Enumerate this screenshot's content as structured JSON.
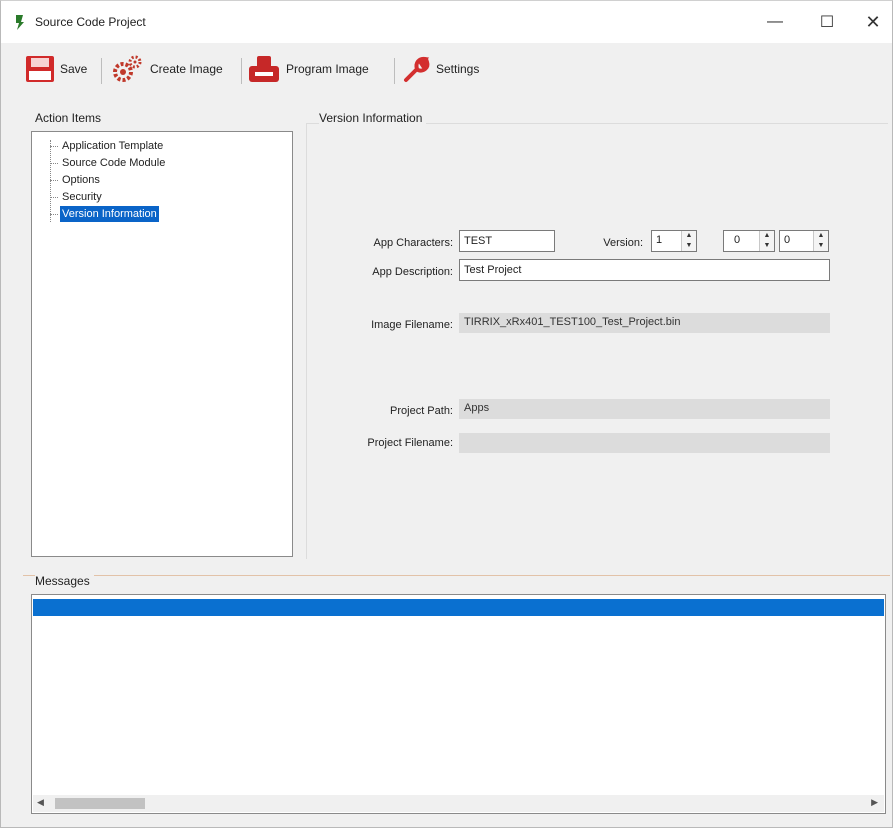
{
  "window": {
    "title": "Source Code Project",
    "controls": {
      "minimize": "—",
      "maximize": "☐",
      "close": "✕"
    }
  },
  "toolbar": {
    "items": [
      {
        "label": "Save",
        "icon": "floppy-disk-icon",
        "color": "#d12a2a"
      },
      {
        "label": "Create Image",
        "icon": "gears-icon",
        "color": "#c0392b"
      },
      {
        "label": "Program Image",
        "icon": "programmer-icon",
        "color": "#c62828"
      },
      {
        "label": "Settings",
        "icon": "wrench-icon",
        "color": "#d32f2f"
      }
    ]
  },
  "action_items": {
    "label": "Action Items",
    "items": [
      {
        "label": "Application Template",
        "selected": false
      },
      {
        "label": "Source Code Module",
        "selected": false
      },
      {
        "label": "Options",
        "selected": false
      },
      {
        "label": "Security",
        "selected": false
      },
      {
        "label": "Version Information",
        "selected": true
      }
    ]
  },
  "version_info": {
    "label": "Version Information",
    "app_characters": {
      "label": "App Characters:",
      "value": "TEST"
    },
    "version": {
      "label": "Version:",
      "major": "1",
      "minor": "0",
      "patch": "0"
    },
    "app_description": {
      "label": "App Description:",
      "value": "Test Project"
    },
    "image_filename": {
      "label": "Image Filename:",
      "value": "TIRRIX_xRx401_TEST100_Test_Project.bin"
    },
    "project_path": {
      "label": "Project Path:",
      "value": "Apps"
    },
    "project_filename": {
      "label": "Project Filename:",
      "value": ""
    }
  },
  "messages": {
    "label": "Messages"
  },
  "colors": {
    "selection": "#0a64c8",
    "accent_red": "#d12a2a"
  }
}
